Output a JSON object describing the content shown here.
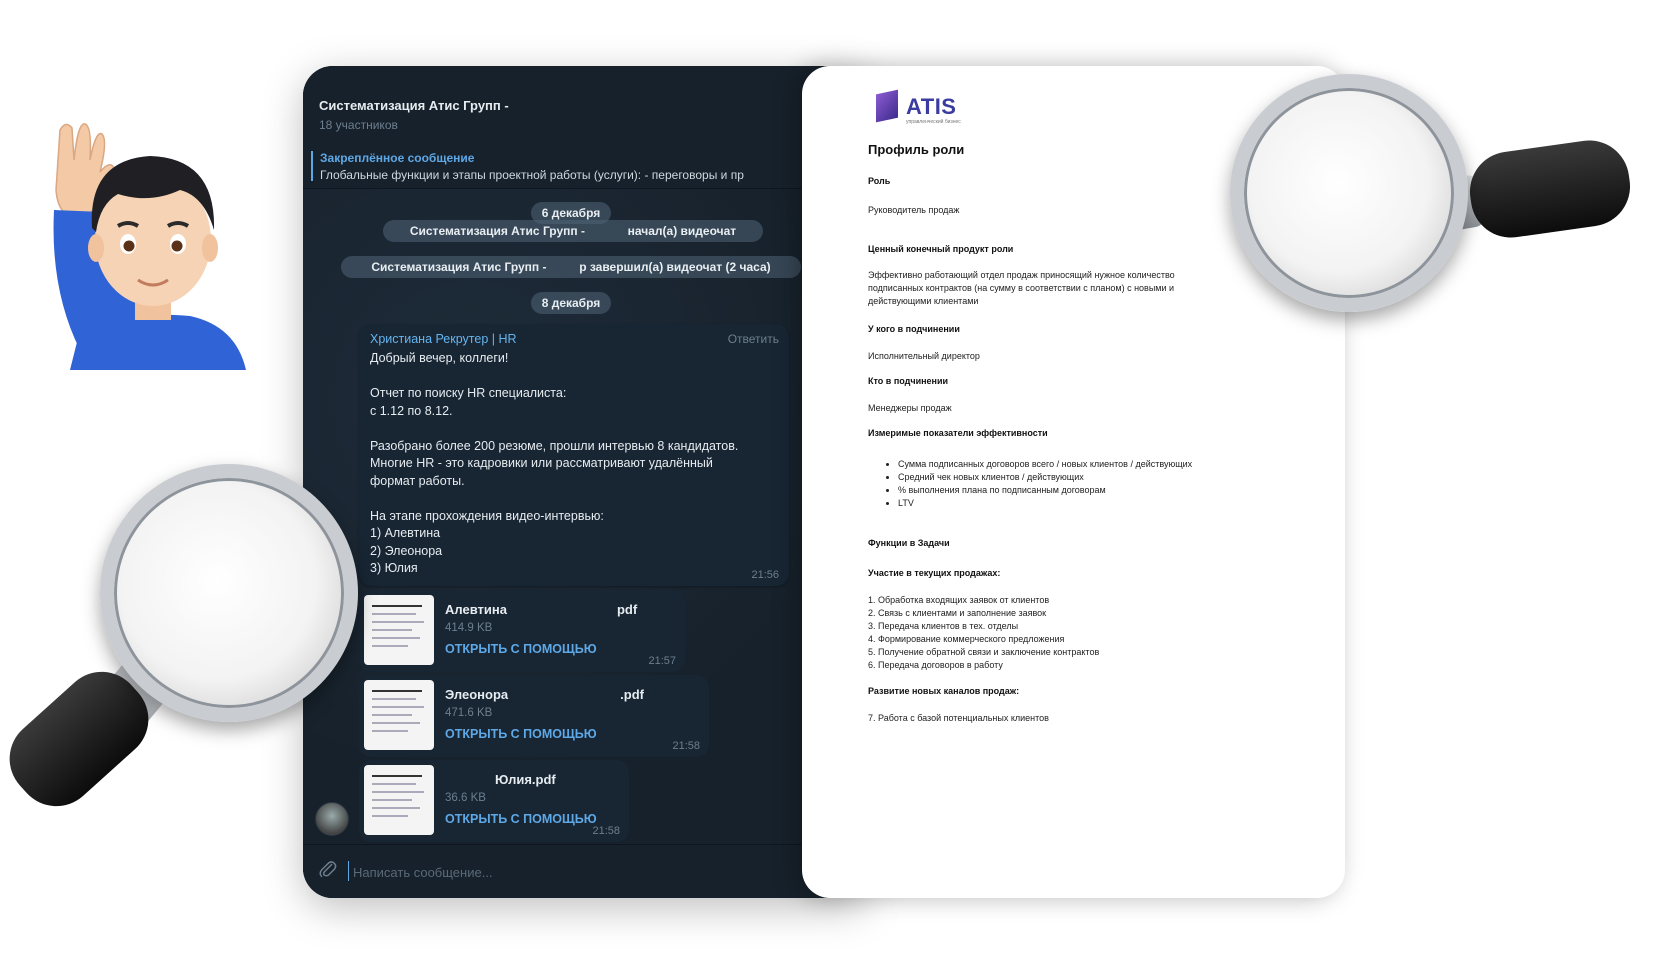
{
  "chat": {
    "group_title": "Систематизация Атис Групп -",
    "members": "18 участников",
    "pinned_title": "Закреплённое сообщение",
    "pinned_text": "Глобальные функции и этапы проектной работы (услуги): - переговоры и пр",
    "date1": "6 декабря",
    "event1_left": "Систематизация Атис Групп -",
    "event1_right": "начал(а) видеочат",
    "event2_left": "Систематизация Атис Групп -",
    "event2_right": "р завершил(а) видеочат (2 часа)",
    "date2": "8 декабря",
    "message": {
      "author": "Христиана Рекрутер | HR",
      "reply": "Ответить",
      "text": "Добрый вечер, коллеги!\n\nОтчет по поиску HR специалиста:\nс 1.12 по 8.12.\n\nРазобрано более 200 резюме, прошли интервью 8 кандидатов.\nМногие HR - это кадровики или рассматривают удалённый\nформат работы.\n\nНа этапе прохождения видео-интервью:\n1)              Алевтина\n2)              Элеонора\n3)              Юлия",
      "time": "21:56"
    },
    "files": [
      {
        "name": "Алевтина",
        "ext": "pdf",
        "size": "414.9 KB",
        "open": "ОТКРЫТЬ С ПОМОЩЬЮ",
        "time": "21:57"
      },
      {
        "name": "Элеонора",
        "ext": ".pdf",
        "size": "471.6 KB",
        "open": "ОТКРЫТЬ С ПОМОЩЬЮ",
        "time": "21:58"
      },
      {
        "name": "Юлия.pdf",
        "ext": "",
        "size": "36.6 KB",
        "open": "ОТКРЫТЬ С ПОМОЩЬЮ",
        "time": "21:58"
      }
    ],
    "composer_placeholder": "Написать сообщение..."
  },
  "doc": {
    "logo": "ATIS",
    "logo_sub": "управленческий бизнес",
    "title": "Профиль роли",
    "role_h": "Роль",
    "role": "Руководитель продаж",
    "product_h": "Ценный конечный продукт роли",
    "product_lines": [
      "Эффективно работающий отдел продаж приносящий нужное количество",
      "подписанных контрактов (на сумму в соответствии с планом) с новыми и",
      "действующими клиентами"
    ],
    "boss_h": "У кого в подчинении",
    "boss": "Исполнительный директор",
    "subs_h": "Кто в подчинении",
    "subs": "Менеджеры продаж",
    "kpi_h": "Измеримые показатели эффективности",
    "kpi": [
      "Сумма подписанных договоров всего / новых клиентов / действующих",
      "Средний чек новых клиентов / действующих",
      "% выполнения плана по подписанным договорам",
      "LTV"
    ],
    "func_h": "Функции в Задачи",
    "current_h": "Участие в текущих продажах:",
    "current": [
      "1. Обработка входящих заявок от клиентов",
      "2. Связь с клиентами и заполнение заявок",
      "3. Передача клиентов в тех. отделы",
      "4. Формирование коммерческого предложения",
      "5. Получение обратной связи и заключение контрактов",
      "6. Передача договоров в работу"
    ],
    "new_h": "Развитие новых каналов продаж:",
    "new": [
      "7. Работа с базой потенциальных клиентов"
    ]
  },
  "icons": {
    "person": "raising-hand-person-icon",
    "magnifier": "magnifying-glass-icon",
    "attach": "paperclip-icon"
  },
  "colors": {
    "chat_bg": "#17212b",
    "bubble": "#182533",
    "accent": "#5ea8e6",
    "logo": "#3b3ca0"
  }
}
